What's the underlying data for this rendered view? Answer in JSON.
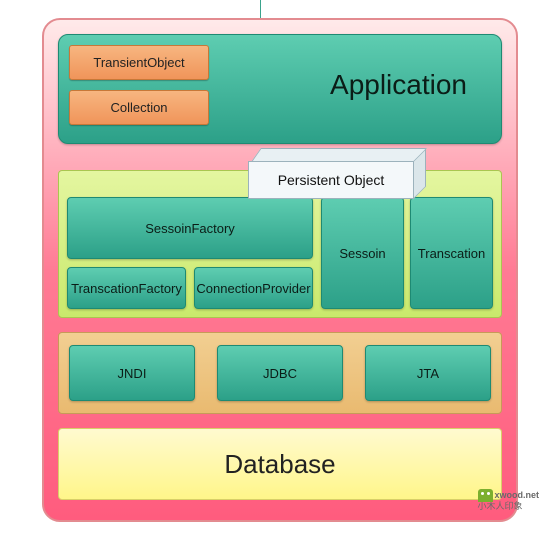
{
  "application": {
    "title": "Application",
    "transient_object": "TransientObject",
    "collection": "Collection"
  },
  "persistent_object": "Persistent Object",
  "hibernate_layer": {
    "session_factory": "SessoinFactory",
    "transaction_factory": "TranscationFactory",
    "connection_provider": "ConnectionProvider",
    "session": "Sessoin",
    "transaction": "Transcation"
  },
  "tech_layer": {
    "jndi": "JNDI",
    "jdbc": "JDBC",
    "jta": "JTA"
  },
  "database": "Database",
  "watermark": {
    "site": "xwood.net",
    "tagline": "小木人印象"
  }
}
